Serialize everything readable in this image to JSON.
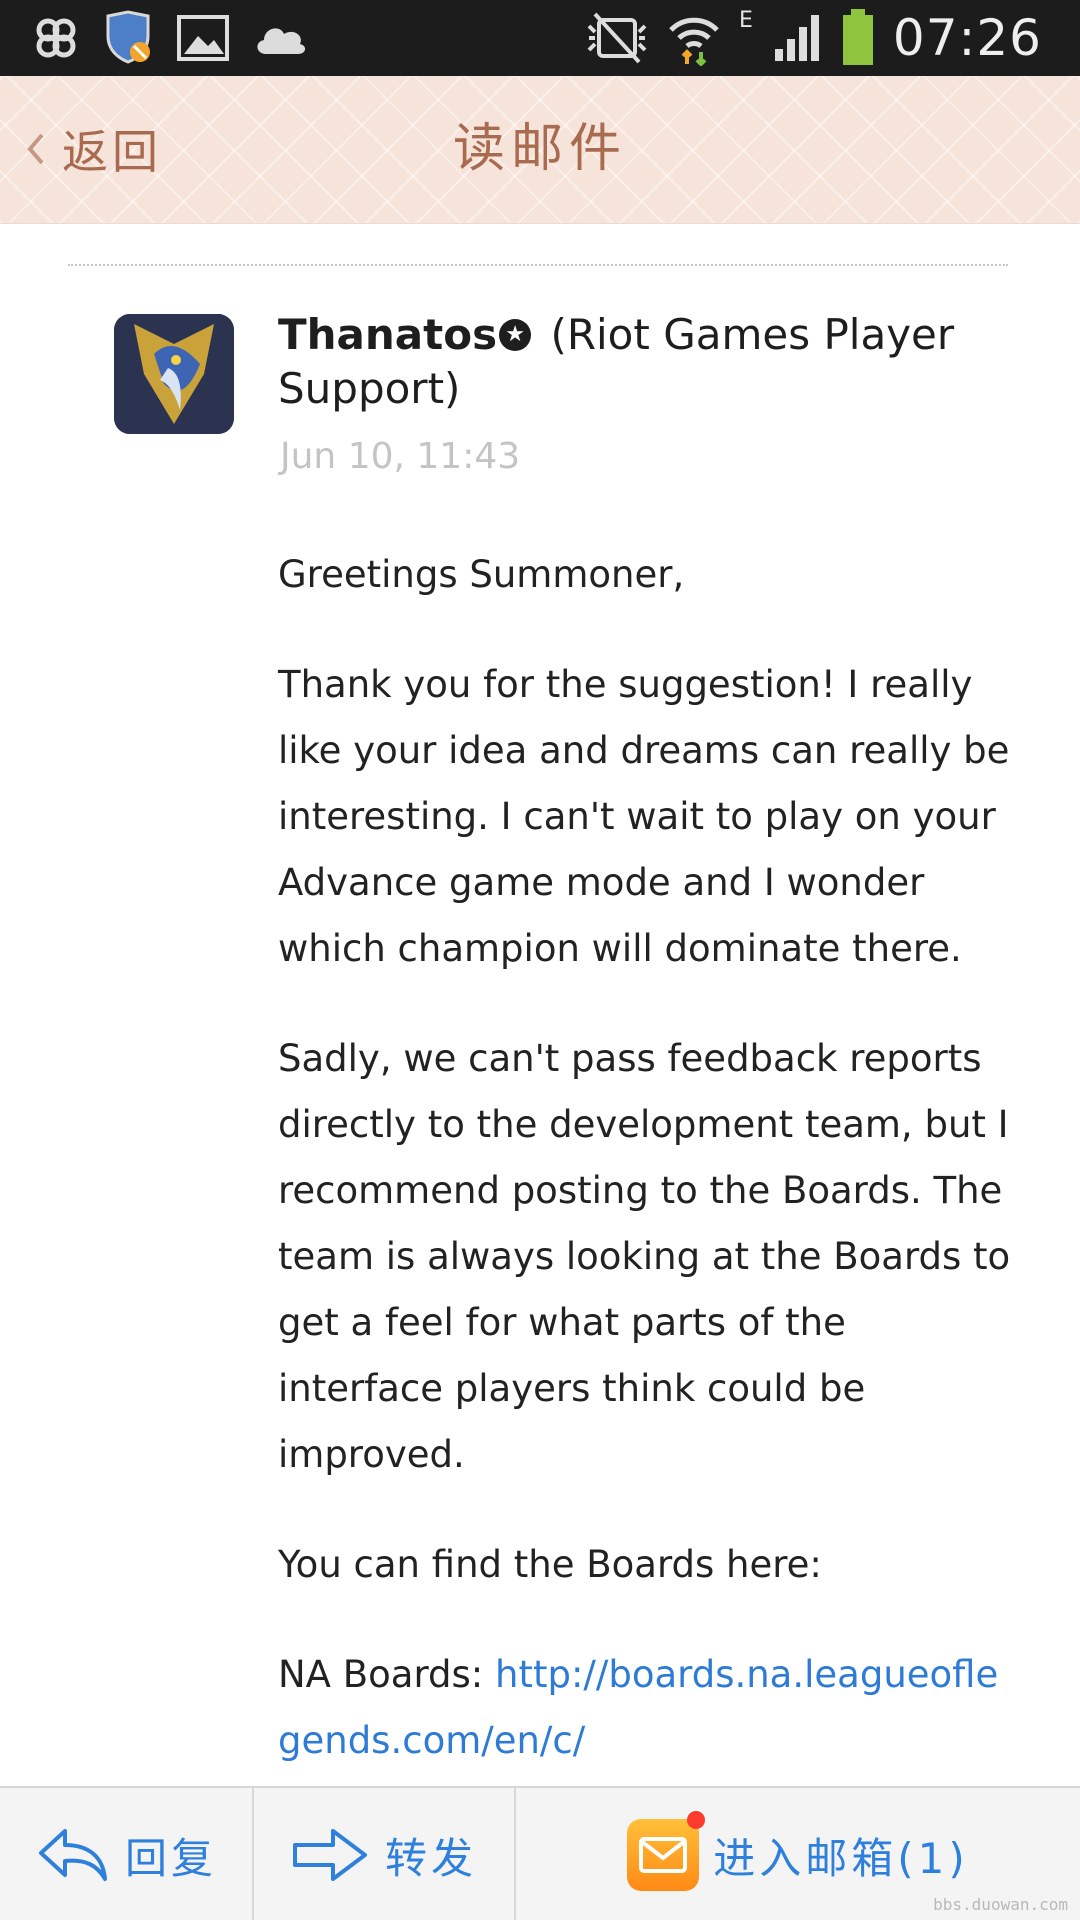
{
  "status_bar": {
    "time": "07:26",
    "network_type": "E",
    "left_icons": [
      "app-icon",
      "shield-icon",
      "gallery-icon",
      "cloud-icon"
    ],
    "right_icons": [
      "mute-icon",
      "wifi-icon",
      "signal-icon",
      "battery-icon"
    ]
  },
  "header": {
    "back_label": "返回",
    "title": "读邮件",
    "colors": {
      "background": "#f6e3da",
      "text": "#a96b50"
    }
  },
  "mail": {
    "sender_name": "Thanatos",
    "sender_affiliation": "(Riot Games Player Support)",
    "date": "Jun 10, 11:43",
    "paragraphs": [
      "Greetings Summoner,",
      "Thank you for the suggestion! I really like your idea and dreams can really be interesting. I can't wait to play on your Advance game mode and I wonder which champion will dominate there.",
      "Sadly, we can't pass feedback reports directly to the development team, but I recommend posting to the Boards. The team is always looking at the Boards to get a feel for what parts of the interface players think could be improved.",
      "You can find the Boards here:"
    ],
    "boards_prefix": "NA Boards:",
    "boards_link": "http://boards.na.leagueoflegends.com/en/c/"
  },
  "bottom_bar": {
    "reply_label": "回复",
    "forward_label": "转发",
    "inbox_label": "进入邮箱(1)",
    "accent_color": "#2f80dc"
  },
  "watermark": "bbs.duowan.com"
}
